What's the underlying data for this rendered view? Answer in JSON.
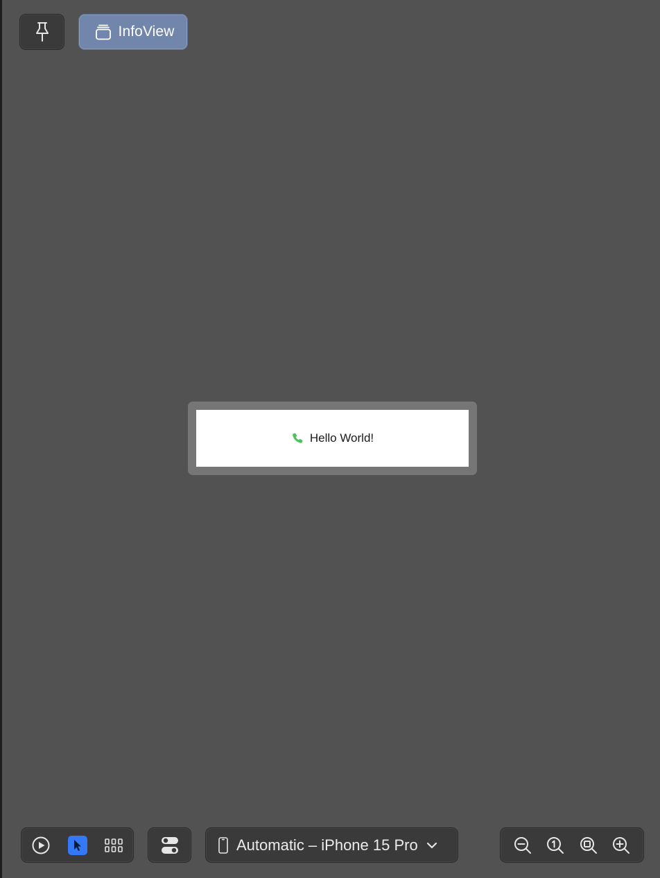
{
  "header": {
    "pin_button": {
      "icon": "pin-icon"
    },
    "preview_tab": {
      "icon": "stack-icon",
      "label": "InfoView"
    }
  },
  "preview": {
    "icon": "phone-icon",
    "text": "Hello World!",
    "icon_color": "#4cc35c"
  },
  "toolbar": {
    "live_button": {
      "icon": "play-circle-icon"
    },
    "selectable_button": {
      "icon": "cursor-arrow-icon",
      "selected": true
    },
    "variants_grid_button": {
      "icon": "grid-icon"
    },
    "settings_button": {
      "icon": "toggles-icon"
    },
    "device_selector": {
      "icon": "iphone-icon",
      "label": "Automatic – iPhone 15 Pro",
      "chevron": "chevron-down-icon"
    },
    "zoom_out": {
      "icon": "zoom-out-icon"
    },
    "zoom_100": {
      "icon": "zoom-actual-size-icon"
    },
    "zoom_fit": {
      "icon": "zoom-to-fit-icon"
    },
    "zoom_in": {
      "icon": "zoom-in-icon"
    }
  },
  "colors": {
    "canvas_bg": "#525252",
    "accent": "#3478f6",
    "tab_active": "#7186aa"
  }
}
